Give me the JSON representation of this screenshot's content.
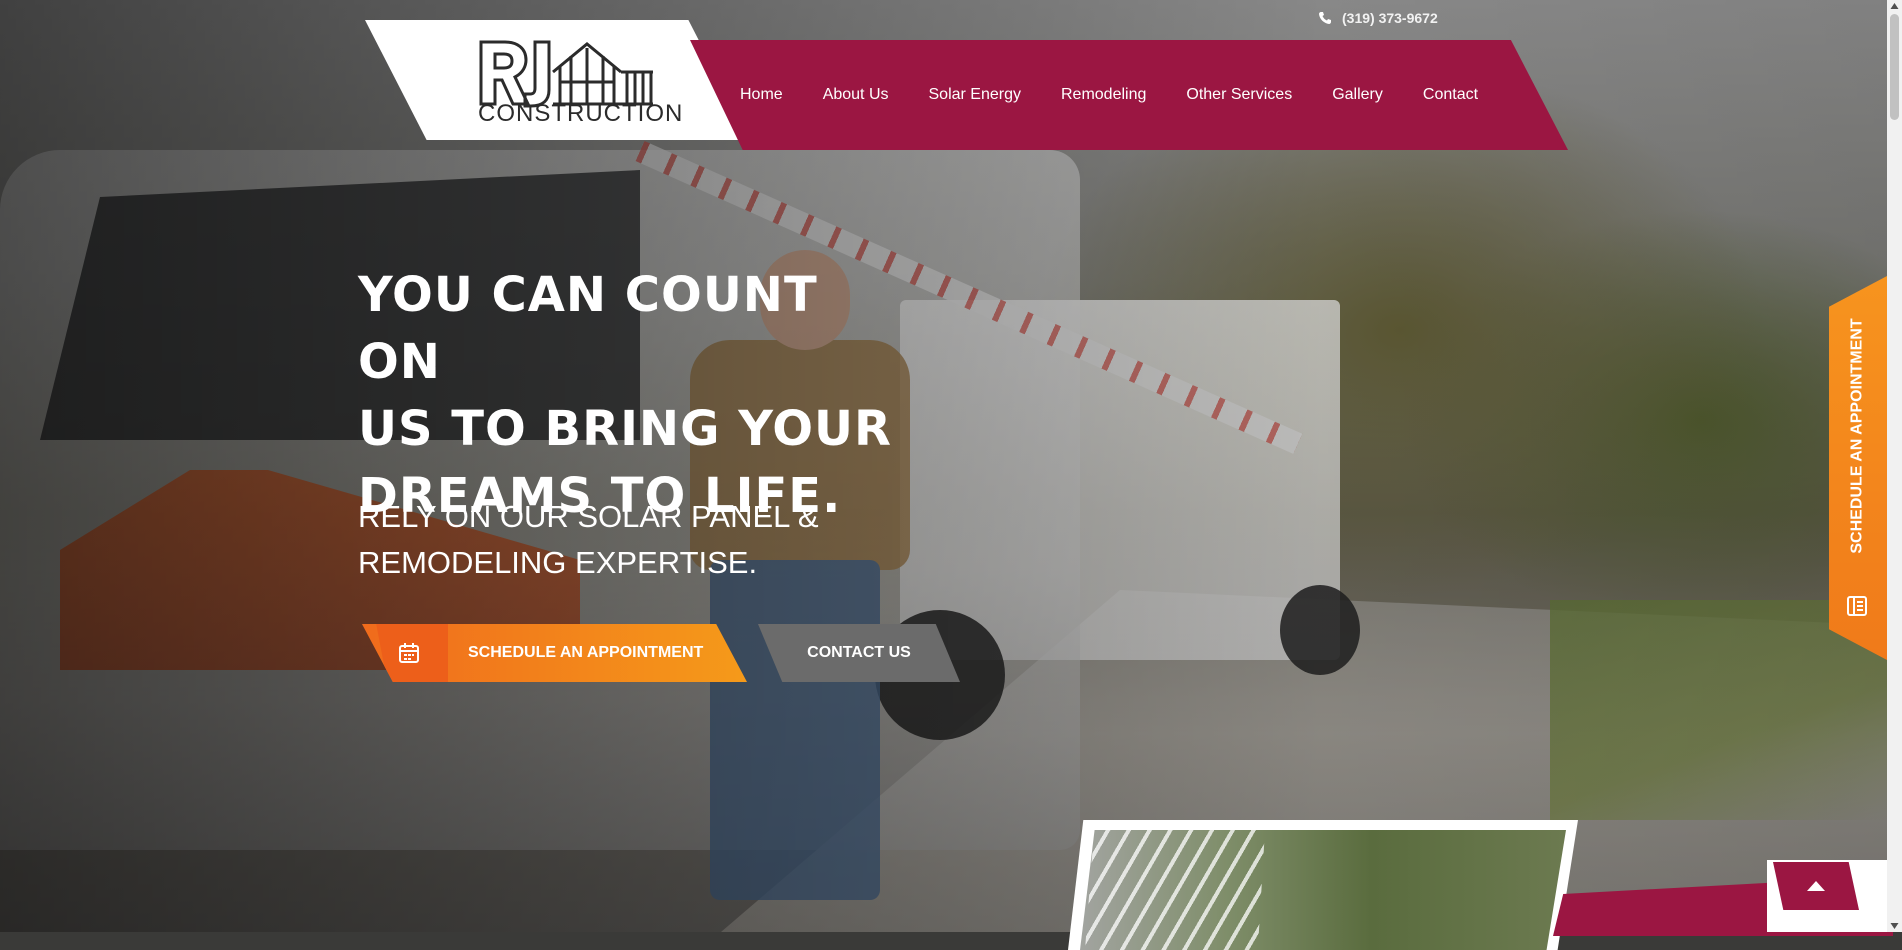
{
  "header": {
    "phone": "(319) 373-9672",
    "logo_letters": "RJ",
    "logo_word": "CONSTRUCTION",
    "nav": [
      "Home",
      "About Us",
      "Solar Energy",
      "Remodeling",
      "Other Services",
      "Gallery",
      "Contact"
    ]
  },
  "hero": {
    "headline_lines": [
      "YOU CAN COUNT ON",
      "US TO BRING YOUR",
      "DREAMS TO LIFE."
    ],
    "subline_lines": [
      "RELY ON OUR SOLAR PANEL &",
      "REMODELING EXPERTISE."
    ],
    "appointment_button": "SCHEDULE AN APPOINTMENT",
    "contact_button": "CONTACT US"
  },
  "side_tab": {
    "label": "SCHEDULE AN APPOINTMENT"
  },
  "icons": {
    "phone": "phone-icon",
    "calendar": "calendar-icon",
    "form": "form-icon",
    "to_top": "arrow-up-icon"
  },
  "colors": {
    "brand_maroon": "#9b1642",
    "accent_orange": "#f07a1a",
    "button_gray": "#6b6b6b"
  }
}
